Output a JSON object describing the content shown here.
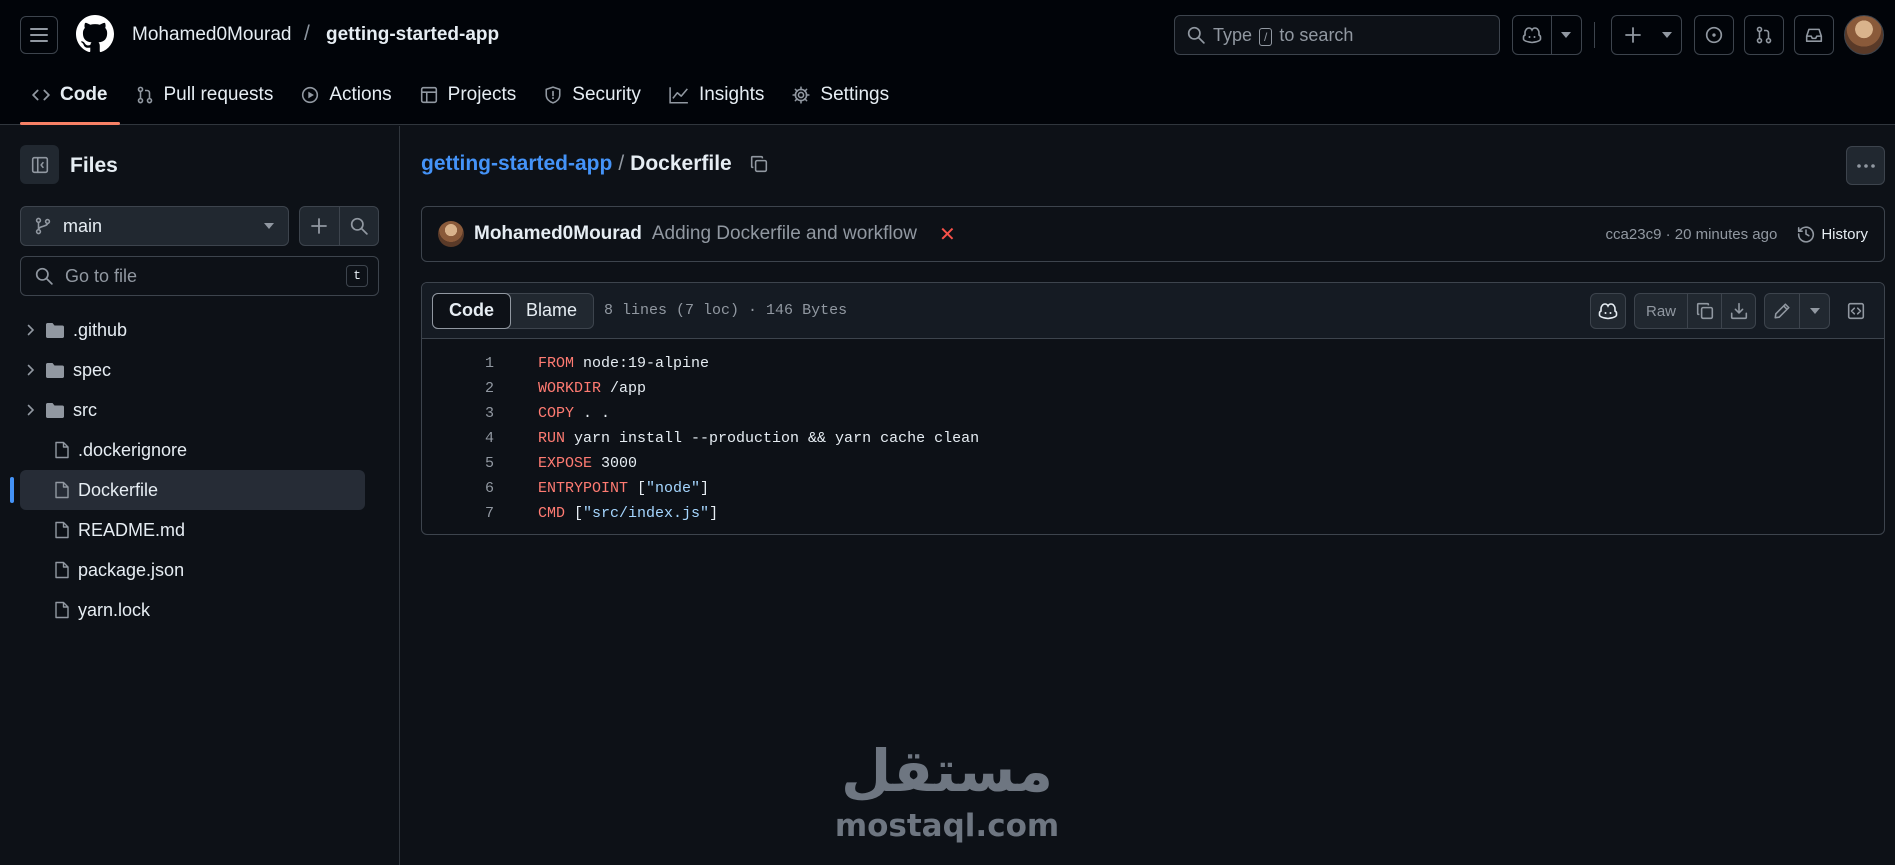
{
  "header": {
    "owner": "Mohamed0Mourad",
    "separator": "/",
    "repo": "getting-started-app",
    "search_prefix": "Type",
    "search_key": "/",
    "search_suffix": "to search"
  },
  "repo_nav": {
    "tabs": [
      {
        "label": "Code",
        "icon": "code-icon",
        "active": true
      },
      {
        "label": "Pull requests",
        "icon": "pull-request-icon"
      },
      {
        "label": "Actions",
        "icon": "play-icon"
      },
      {
        "label": "Projects",
        "icon": "table-icon"
      },
      {
        "label": "Security",
        "icon": "shield-icon"
      },
      {
        "label": "Insights",
        "icon": "graph-icon"
      },
      {
        "label": "Settings",
        "icon": "gear-icon"
      }
    ]
  },
  "sidebar": {
    "title": "Files",
    "branch": "main",
    "goto_placeholder": "Go to file",
    "goto_shortcut": "t",
    "tree": [
      {
        "name": ".github",
        "type": "folder"
      },
      {
        "name": "spec",
        "type": "folder"
      },
      {
        "name": "src",
        "type": "folder"
      },
      {
        "name": ".dockerignore",
        "type": "file"
      },
      {
        "name": "Dockerfile",
        "type": "file",
        "selected": true
      },
      {
        "name": "README.md",
        "type": "file"
      },
      {
        "name": "package.json",
        "type": "file"
      },
      {
        "name": "yarn.lock",
        "type": "file"
      }
    ]
  },
  "file": {
    "repo_link": "getting-started-app",
    "separator": "/",
    "name": "Dockerfile"
  },
  "commit": {
    "author": "Mohamed0Mourad",
    "message": "Adding Dockerfile and workflow",
    "status": "✕",
    "meta": "cca23c9 · 20 minutes ago",
    "history_label": "History"
  },
  "code_view": {
    "tab_code": "Code",
    "tab_blame": "Blame",
    "info": "8 lines (7 loc) · 146 Bytes",
    "raw_label": "Raw",
    "lines": [
      {
        "num": "1",
        "kw": "FROM",
        "rest": " node:19-alpine",
        "str": ""
      },
      {
        "num": "2",
        "kw": "WORKDIR",
        "rest": " /app",
        "str": ""
      },
      {
        "num": "3",
        "kw": "COPY",
        "rest": " . .",
        "str": ""
      },
      {
        "num": "4",
        "kw": "RUN",
        "rest": " yarn install --production && yarn cache clean",
        "str": ""
      },
      {
        "num": "5",
        "kw": "EXPOSE",
        "rest": " 3000",
        "str": ""
      },
      {
        "num": "6",
        "kw": "ENTRYPOINT",
        "rest": " [",
        "str": "\"node\"",
        "tail": "]"
      },
      {
        "num": "7",
        "kw": "CMD",
        "rest": " [",
        "str": "\"src/index.js\"",
        "tail": "]"
      }
    ]
  },
  "watermark": {
    "arabic": "مستقل",
    "latin": "mostaql.com"
  },
  "colors": {
    "accent": "#f78166",
    "link": "#4493f8",
    "keyword": "#ff7b72",
    "string": "#a5d6ff",
    "background": "#0d1117"
  }
}
